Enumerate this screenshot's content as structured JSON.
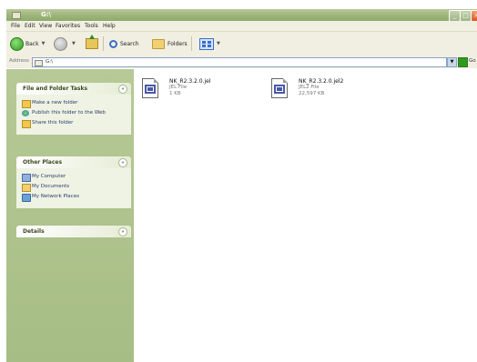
{
  "window": {
    "title": "G:\\"
  },
  "menu": [
    "File",
    "Edit",
    "View",
    "Favorites",
    "Tools",
    "Help"
  ],
  "toolbar": {
    "back_label": "Back",
    "search_label": "Search",
    "folders_label": "Folders"
  },
  "address": {
    "label": "Address",
    "value": "G:\\",
    "go_label": "Go"
  },
  "sidebar": {
    "tasks": {
      "title": "File and Folder Tasks",
      "items": [
        "Make a new folder",
        "Publish this folder to the Web",
        "Share this folder"
      ]
    },
    "places": {
      "title": "Other Places",
      "items": [
        "My Computer",
        "My Documents",
        "My Network Places"
      ]
    },
    "details": {
      "title": "Details"
    }
  },
  "files": [
    {
      "name": "NK_R2.3.2.0.jel",
      "type": "JEL File",
      "size": "1 KB"
    },
    {
      "name": "NK_R2.3.2.0.jel2",
      "type": "JEL2 File",
      "size": "22,597 KB"
    }
  ],
  "icons": {
    "back": "back-arrow-icon",
    "forward": "forward-arrow-icon",
    "up": "up-folder-icon",
    "search": "search-icon",
    "folders": "folders-icon",
    "views": "views-icon"
  }
}
